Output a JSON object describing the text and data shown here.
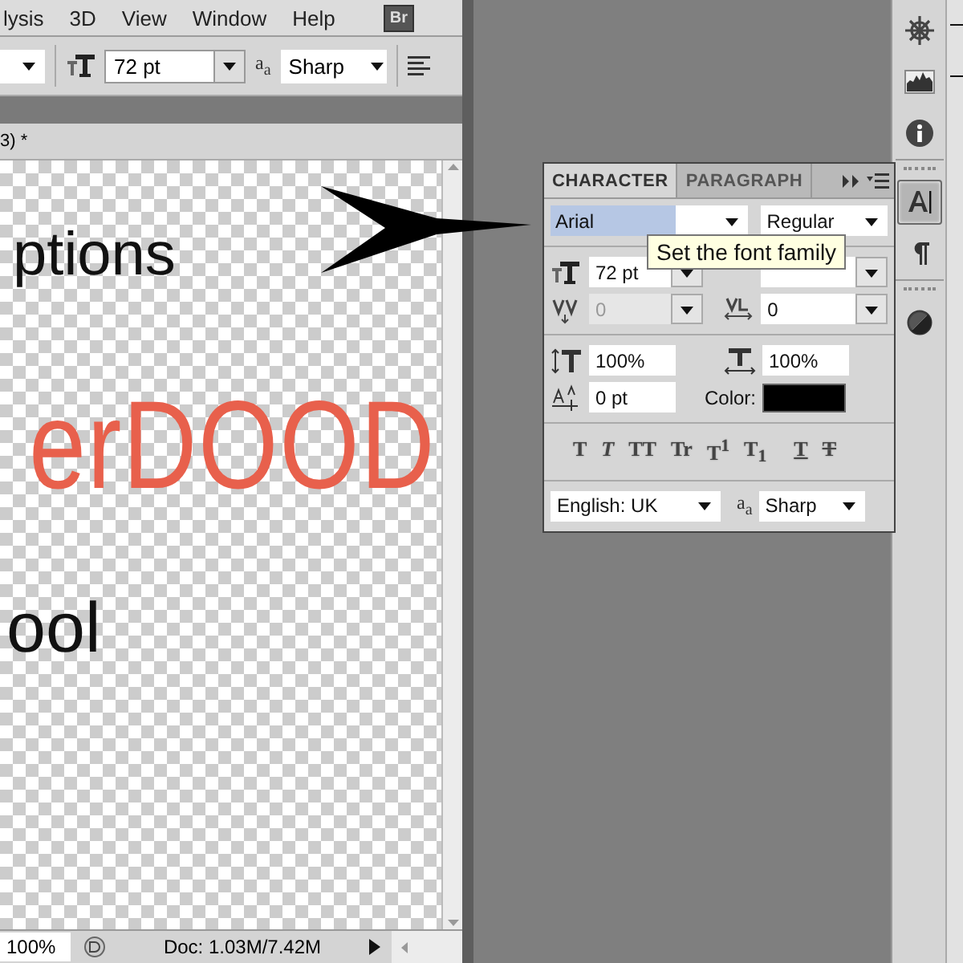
{
  "menu_bar": {
    "items": [
      "lysis",
      "3D",
      "View",
      "Window",
      "Help"
    ],
    "bridge_button": "Br"
  },
  "options_bar": {
    "font_size": "72 pt",
    "antialias_symbol": "a$_{a}$",
    "antialias": "Sharp"
  },
  "document": {
    "tab_title": "3) *",
    "canvas_texts": [
      {
        "text": "ptions",
        "color": "#111111"
      },
      {
        "text": "erDOOD",
        "color": "#e8604c"
      },
      {
        "text": "ool",
        "color": "#111111"
      }
    ],
    "zoom": "100%",
    "doc_info": "Doc: 1.03M/7.42M"
  },
  "character_panel": {
    "tabs": [
      {
        "label": "CHARACTER",
        "selected": true
      },
      {
        "label": "PARAGRAPH",
        "selected": false
      }
    ],
    "font_family": "Arial",
    "font_style": "Regular",
    "tooltip": "Set the font family",
    "font_size": "72 pt",
    "kerning": {
      "value": "0",
      "disabled": true
    },
    "tracking": "0",
    "vertical_scale": "100%",
    "horizontal_scale": "100%",
    "baseline_shift": "0 pt",
    "color_label": "Color:",
    "text_color": {
      "color": "#000000"
    },
    "style_buttons": [
      {
        "label": "T",
        "kind": "bold"
      },
      {
        "label": "T",
        "kind": "italic"
      },
      {
        "label": "TT",
        "kind": "caps"
      },
      {
        "label": "Tr",
        "kind": "smallcaps"
      },
      {
        "label": "T$^{1}$",
        "kind": "superscript"
      },
      {
        "label": "T$_{1}$",
        "kind": "subscript"
      },
      {
        "label": "T",
        "kind": "underline"
      },
      {
        "label": "T",
        "kind": "strikethrough"
      }
    ],
    "language": "English: UK",
    "antialias_symbol": "a$_{a}$",
    "antialias": "Sharp"
  },
  "dock": [
    {
      "kind": "navigator",
      "selected": false
    },
    {
      "kind": "histogram",
      "selected": false
    },
    {
      "kind": "info",
      "selected": false
    },
    {
      "kind": "grip"
    },
    {
      "kind": "character",
      "selected": true
    },
    {
      "kind": "paragraph",
      "selected": false
    },
    {
      "kind": "grip"
    },
    {
      "kind": "masks",
      "selected": false
    }
  ]
}
